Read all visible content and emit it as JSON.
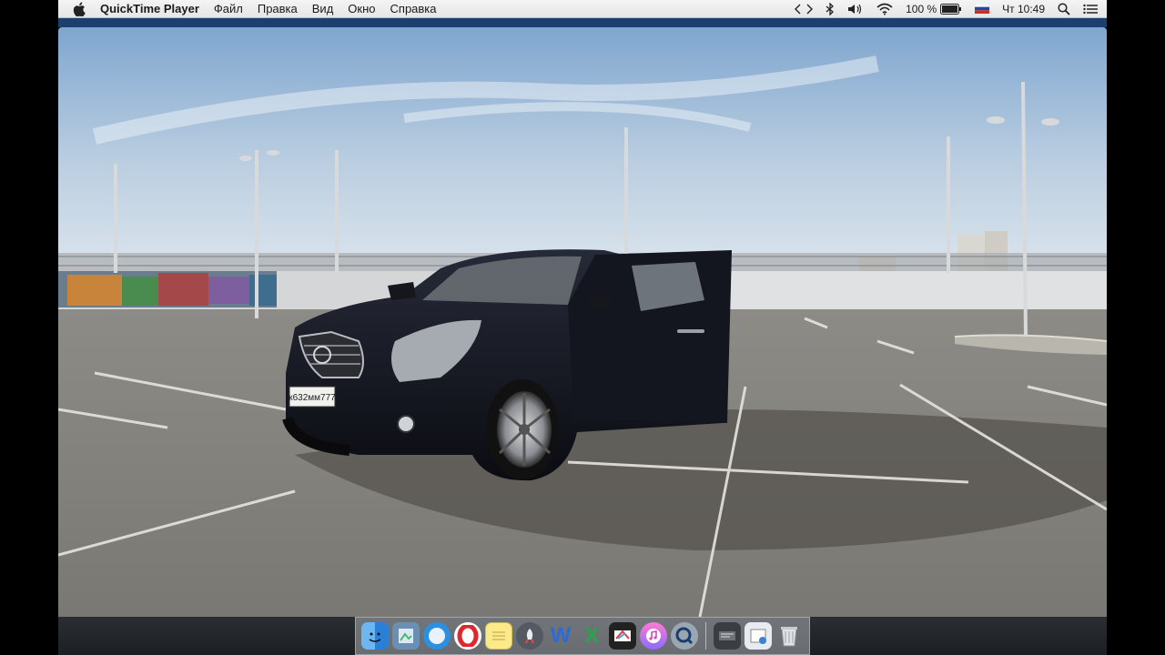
{
  "menubar": {
    "app_name": "QuickTime Player",
    "menus": [
      "Файл",
      "Правка",
      "Вид",
      "Окно",
      "Справка"
    ],
    "battery": "100 %",
    "clock": "Чт 10:49"
  },
  "video": {
    "plate_text": "к632мм777"
  },
  "dock": {
    "items": [
      {
        "name": "finder-icon",
        "label": ""
      },
      {
        "name": "preview-icon",
        "label": ""
      },
      {
        "name": "safari-icon",
        "label": ""
      },
      {
        "name": "opera-icon",
        "label": ""
      },
      {
        "name": "notes-icon",
        "label": ""
      },
      {
        "name": "launchpad-icon",
        "label": ""
      },
      {
        "name": "word-icon",
        "label": "W"
      },
      {
        "name": "excel-icon",
        "label": "X"
      },
      {
        "name": "final-cut-icon",
        "label": ""
      },
      {
        "name": "itunes-icon",
        "label": ""
      },
      {
        "name": "quicktime-icon",
        "label": ""
      },
      {
        "name": "system-info-icon",
        "label": ""
      },
      {
        "name": "preview-doc-icon",
        "label": ""
      },
      {
        "name": "trash-icon",
        "label": ""
      }
    ]
  }
}
